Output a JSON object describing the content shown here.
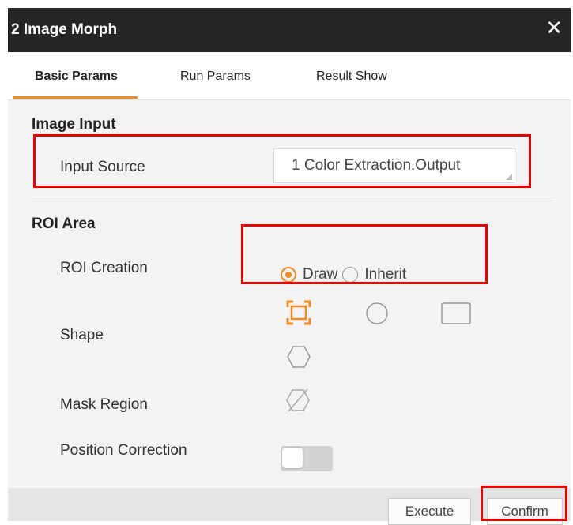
{
  "dialog": {
    "title": "2 Image Morph",
    "close_icon": "close-icon"
  },
  "tabs": [
    {
      "label": "Basic Params",
      "active": true
    },
    {
      "label": "Run Params",
      "active": false
    },
    {
      "label": "Result Show",
      "active": false
    }
  ],
  "image_input": {
    "section_title": "Image Input",
    "input_source_label": "Input Source",
    "input_source_value": "1 Color Extraction.Output"
  },
  "roi_area": {
    "section_title": "ROI Area",
    "roi_creation_label": "ROI Creation",
    "roi_options": [
      {
        "label": "Draw",
        "checked": true
      },
      {
        "label": "Inherit",
        "checked": false
      }
    ],
    "shape_label": "Shape",
    "shapes": [
      "bounding-box-icon",
      "circle-icon",
      "rectangle-icon",
      "hexagon-icon"
    ],
    "mask_region_label": "Mask Region",
    "mask_icon": "mask-disabled-icon",
    "position_correction_label": "Position Correction",
    "position_correction_on": false
  },
  "footer": {
    "execute_label": "Execute",
    "confirm_label": "Confirm"
  },
  "colors": {
    "accent": "#f08a24",
    "highlight": "#e60000",
    "titlebar": "#262626"
  }
}
